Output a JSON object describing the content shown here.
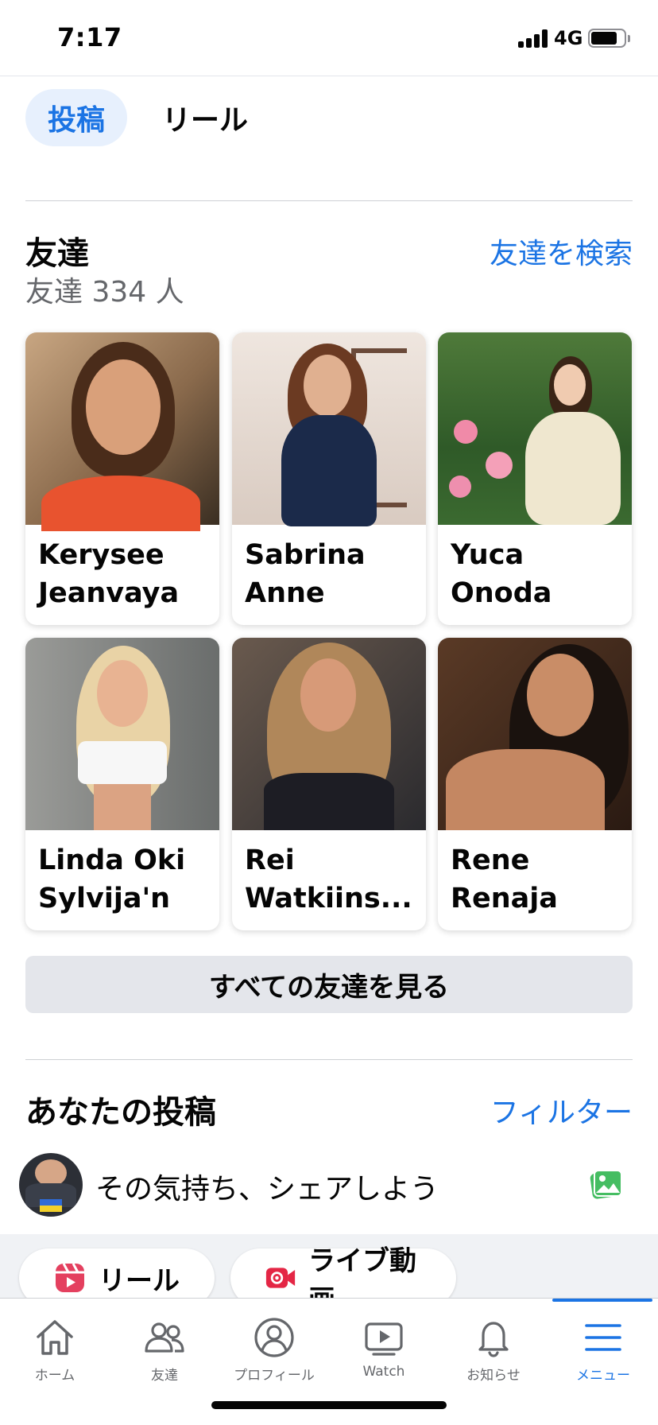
{
  "status_bar": {
    "time": "7:17",
    "network": "4G"
  },
  "tabs": [
    {
      "label": "投稿",
      "active": true
    },
    {
      "label": "リール",
      "active": false
    }
  ],
  "friends": {
    "title": "友達",
    "count_text": "友達 334 人",
    "search_link": "友達を検索",
    "items": [
      {
        "name": "Kerysee Jeanvaya"
      },
      {
        "name": "Sabrina Anne"
      },
      {
        "name": "Yuca Onoda"
      },
      {
        "name": "Linda Oki Sylvija'n"
      },
      {
        "name": "Rei Watkiins..."
      },
      {
        "name": "Rene Renaja"
      }
    ],
    "see_all_label": "すべての友達を見る"
  },
  "posts": {
    "title": "あなたの投稿",
    "filter_link": "フィルター",
    "composer_placeholder": "その気持ち、シェアしよう"
  },
  "quick_actions": [
    {
      "label": "リール",
      "icon": "reels-icon",
      "color": "#e4405f"
    },
    {
      "label": "ライブ動画",
      "icon": "live-video-icon",
      "color": "#e42645"
    }
  ],
  "bottom_nav": [
    {
      "label": "ホーム",
      "icon": "home-icon",
      "active": false
    },
    {
      "label": "友達",
      "icon": "friends-icon",
      "active": false
    },
    {
      "label": "プロフィール",
      "icon": "profile-icon",
      "active": false
    },
    {
      "label": "Watch",
      "icon": "watch-icon",
      "active": false
    },
    {
      "label": "お知らせ",
      "icon": "bell-icon",
      "active": false
    },
    {
      "label": "メニュー",
      "icon": "menu-icon",
      "active": true
    }
  ],
  "colors": {
    "accent": "#1b74e4",
    "secondary_text": "#65676b",
    "button_bg": "#e4e6eb",
    "photo_icon": "#45bd62"
  }
}
